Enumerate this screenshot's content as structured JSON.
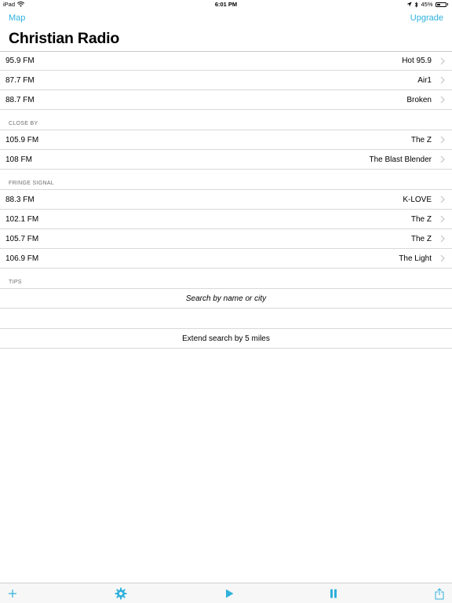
{
  "status_bar": {
    "device": "iPad",
    "time": "6:01 PM",
    "battery": "45%",
    "battery_level": 0.45
  },
  "nav": {
    "left_label": "Map",
    "right_label": "Upgrade",
    "title": "Christian Radio"
  },
  "accent_color": "#2fb1dc",
  "sections": {
    "main": [
      {
        "freq": "95.9 FM",
        "name": "Hot 95.9"
      },
      {
        "freq": "87.7 FM",
        "name": "Air1"
      },
      {
        "freq": "88.7 FM",
        "name": "Broken"
      }
    ],
    "close_by": {
      "header": "CLOSE BY",
      "rows": [
        {
          "freq": "105.9 FM",
          "name": "The Z"
        },
        {
          "freq": "108 FM",
          "name": "The Blast Blender"
        }
      ]
    },
    "fringe": {
      "header": "FRINGE SIGNAL",
      "rows": [
        {
          "freq": "88.3 FM",
          "name": "K-LOVE"
        },
        {
          "freq": "102.1 FM",
          "name": "The Z"
        },
        {
          "freq": "105.7 FM",
          "name": "The Z"
        },
        {
          "freq": "106.9 FM",
          "name": "The Light"
        }
      ]
    },
    "tips": {
      "header": "TIPS",
      "search_hint": "Search by name or city",
      "extend": "Extend search by 5 miles"
    }
  },
  "toolbar": {
    "icons": [
      "plus-icon",
      "gear-icon",
      "play-icon",
      "pause-icon",
      "share-icon"
    ]
  }
}
